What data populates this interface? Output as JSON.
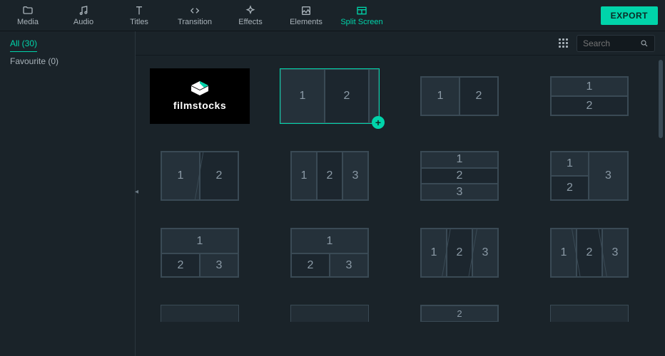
{
  "topbar": {
    "tabs": [
      {
        "id": "media",
        "label": "Media"
      },
      {
        "id": "audio",
        "label": "Audio"
      },
      {
        "id": "titles",
        "label": "Titles"
      },
      {
        "id": "transition",
        "label": "Transition"
      },
      {
        "id": "effects",
        "label": "Effects"
      },
      {
        "id": "elements",
        "label": "Elements"
      },
      {
        "id": "splitscreen",
        "label": "Split Screen",
        "active": true
      }
    ],
    "export_label": "EXPORT"
  },
  "sidebar": {
    "items": [
      {
        "id": "all",
        "label": "All (30)",
        "active": true
      },
      {
        "id": "favourite",
        "label": "Favourite (0)"
      }
    ]
  },
  "toolbar": {
    "search_placeholder": "Search"
  },
  "filmstocks": {
    "label": "filmstocks"
  },
  "split_screen_templates": [
    {
      "id": "filmstocks_promo"
    },
    {
      "id": "2col-narrow-right",
      "cells": [
        "1",
        "2"
      ],
      "selected": true,
      "add": true
    },
    {
      "id": "2col-equal",
      "cells": [
        "1",
        "2"
      ]
    },
    {
      "id": "2row",
      "cells": [
        "1",
        "2"
      ]
    },
    {
      "id": "2col-diagonal",
      "cells": [
        "1",
        "2"
      ]
    },
    {
      "id": "3col",
      "cells": [
        "1",
        "2",
        "3"
      ]
    },
    {
      "id": "3row",
      "cells": [
        "1",
        "2",
        "3"
      ]
    },
    {
      "id": "L-shape-2-1",
      "cells": [
        "1",
        "2",
        "3"
      ]
    },
    {
      "id": "top1-bottom2",
      "cells": [
        "1",
        "2",
        "3"
      ]
    },
    {
      "id": "top1-bottom2-b",
      "cells": [
        "1",
        "2",
        "3"
      ]
    },
    {
      "id": "3col-diagonal",
      "cells": [
        "1",
        "2",
        "3"
      ]
    },
    {
      "id": "3col-diagonal-b",
      "cells": [
        "1",
        "2",
        "3"
      ]
    },
    {
      "id": "partial-row5-a",
      "cells": []
    },
    {
      "id": "partial-row5-b",
      "cells": []
    },
    {
      "id": "partial-row5-c",
      "cells": [
        "2"
      ]
    },
    {
      "id": "partial-row5-d",
      "cells": []
    }
  ],
  "colors": {
    "accent": "#00d4aa",
    "bg": "#1a2329",
    "panel": "#222d35",
    "border": "#3a4a55"
  }
}
